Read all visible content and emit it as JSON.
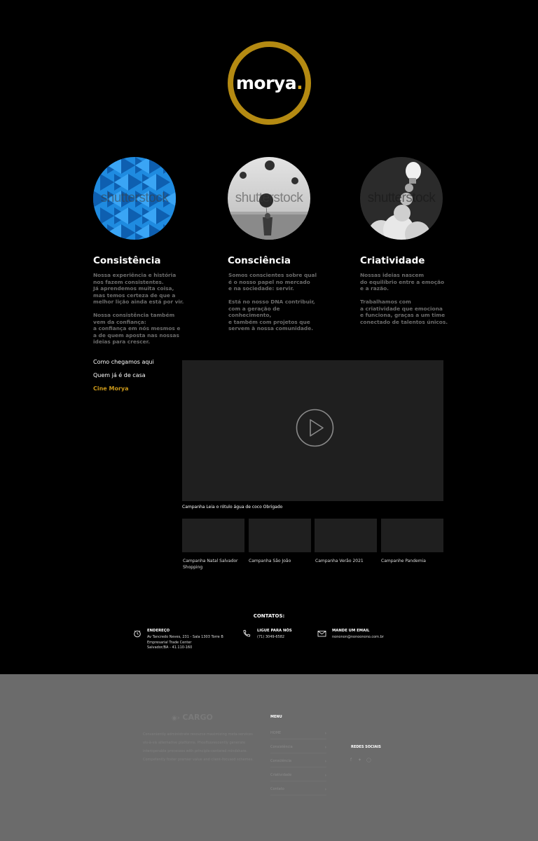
{
  "brand": {
    "name": "morya",
    "dot": ".",
    "accent": "#b48a12"
  },
  "pillars": [
    {
      "title": "Consistência",
      "text": "Nossa experiência e história\nnos fazem consistentes.\nJá aprendemos muita coisa,\nmas temos certeza de que a\nmelhor lição ainda está por vir.\n\nNossa consistência também\nvem da confiança:\na confiança em nós mesmos e\na de quem aposta nas nossas\nideias para crescer.",
      "watermark": "shutterstock"
    },
    {
      "title": "Consciência",
      "text": "Somos conscientes sobre qual\né o nosso papel no mercado\ne na sociedade: servir.\n\nEstá no nosso DNA contribuir,\ncom a geração de\nconhecimento,\ne também com projetos que\nservem à nossa comunidade.",
      "watermark": "shutterstock"
    },
    {
      "title": "Criatividade",
      "text": "Nossas ideias nascem\ndo equilíbrio entre a emoção\ne a razão.\n\nTrabalhamos com\na criatividade que emociona\ne funciona, graças a um time\nconectado de talentos únicos.",
      "watermark": "shutterstock"
    }
  ],
  "side_menu": [
    {
      "label": "Como chegamos aqui"
    },
    {
      "label": "Quem já é de casa"
    },
    {
      "label": "Cine Morya"
    }
  ],
  "video": {
    "caption": "Campanha Leia o rótulo água de coco Obrigado"
  },
  "thumbs": [
    {
      "caption": "Campanha Natal Salvador Shopping"
    },
    {
      "caption": "Campanha São João"
    },
    {
      "caption": "Campanha Verão 2021"
    },
    {
      "caption": "Campanhe Pandemia"
    }
  ],
  "contacts": {
    "title": "CONTATOS:",
    "items": [
      {
        "title": "ENDEREÇO",
        "text": "Av Tancredo Neves, 231 - Sala 1303 Torre B\nEmpresarial Trade Center\nSalvador/BA - 41.110-160",
        "icon": "location-icon"
      },
      {
        "title": "LIGUE PARA NÓS",
        "text": "(71) 3049-6582",
        "icon": "phone-icon"
      },
      {
        "title": "MANDE UM EMAIL",
        "text": "nononon@nonoonono.com.br",
        "icon": "mail-icon"
      }
    ]
  },
  "footer": {
    "logo": "CARGO",
    "description": "Conveniently administrate resource maximizing meta-services\nvis-à-vis alternative platforms. Phosfluorescently generate\ninteroperable processes with principle-centered mindshare.\nCompetently foster premier value and client-focused schemes.",
    "menu_title": "MENU",
    "menu": [
      {
        "label": "HOME"
      },
      {
        "label": "Consistência"
      },
      {
        "label": "Consciência"
      },
      {
        "label": "Criatividade"
      },
      {
        "label": "Contato"
      }
    ],
    "social_title": "REDES SOCIAIS",
    "social": [
      "facebook-icon",
      "twitter-icon",
      "instagram-icon"
    ]
  }
}
